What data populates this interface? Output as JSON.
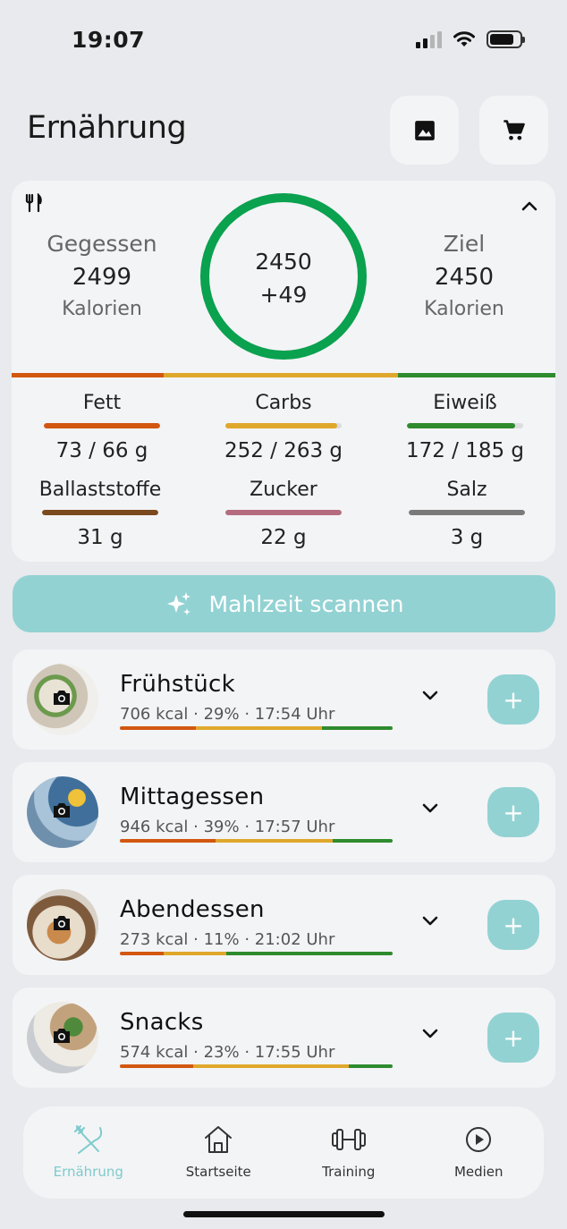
{
  "status": {
    "time": "19:07"
  },
  "header": {
    "title": "Ernährung"
  },
  "summary": {
    "eaten_label": "Gegessen",
    "eaten_value": "2499",
    "eaten_unit": "Kalorien",
    "ring_top": "2450",
    "ring_bottom": "+49",
    "goal_label": "Ziel",
    "goal_value": "2450",
    "goal_unit": "Kalorien"
  },
  "macros": [
    {
      "label": "Fett",
      "value": "73 / 66 g",
      "color": "#d2570f",
      "progress": 1.0
    },
    {
      "label": "Carbs",
      "value": "252 / 263 g",
      "color": "#e0a82b",
      "progress": 0.96
    },
    {
      "label": "Eiweiß",
      "value": "172 / 185 g",
      "color": "#2e8b2e",
      "progress": 0.93
    },
    {
      "label": "Ballaststoffe",
      "value": "31 g",
      "color": "#7a4a1e",
      "progress": 1.0
    },
    {
      "label": "Zucker",
      "value": "22 g",
      "color": "#b56b7e",
      "progress": 1.0
    },
    {
      "label": "Salz",
      "value": "3 g",
      "color": "#7a7a7a",
      "progress": 1.0
    }
  ],
  "scan": {
    "label": "Mahlzeit scannen"
  },
  "meals": [
    {
      "name": "Frühstück",
      "info": "706 kcal · 29% · 17:54 Uhr",
      "split": [
        0.28,
        0.46,
        0.26
      ]
    },
    {
      "name": "Mittagessen",
      "info": "946 kcal · 39% · 17:57 Uhr",
      "split": [
        0.35,
        0.43,
        0.22
      ]
    },
    {
      "name": "Abendessen",
      "info": "273 kcal · 11% · 21:02 Uhr",
      "split": [
        0.16,
        0.23,
        0.61
      ]
    },
    {
      "name": "Snacks",
      "info": "574 kcal · 23% · 17:55 Uhr",
      "split": [
        0.27,
        0.57,
        0.16
      ]
    }
  ],
  "tabs": [
    {
      "label": "Ernährung",
      "icon": "fork-knife-icon",
      "active": true
    },
    {
      "label": "Startseite",
      "icon": "home-icon",
      "active": false
    },
    {
      "label": "Training",
      "icon": "dumbbell-icon",
      "active": false
    },
    {
      "label": "Medien",
      "icon": "play-icon",
      "active": false
    }
  ],
  "colors": {
    "accent": "#93d2d3",
    "ring": "#0aa14f",
    "fat": "#d2570f",
    "carbs": "#e0a82b",
    "protein": "#2e8b2e"
  }
}
